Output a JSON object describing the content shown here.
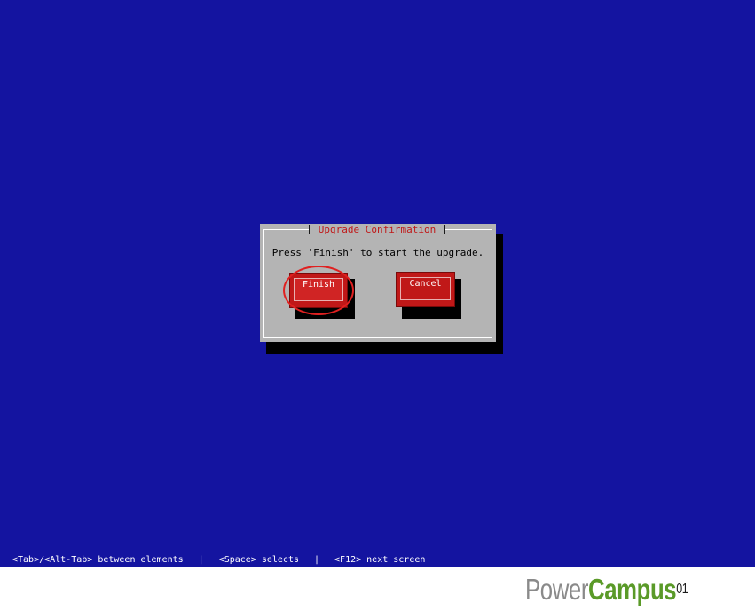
{
  "dialog": {
    "title": "Upgrade Confirmation",
    "message": "Press 'Finish' to start the upgrade.",
    "finish_label": "Finish",
    "cancel_label": "Cancel"
  },
  "statusbar": {
    "hint_tab": "<Tab>/<Alt-Tab> between elements",
    "separator": "|",
    "hint_space": "<Space> selects",
    "hint_f12": "<F12> next screen"
  },
  "logo": {
    "part1": "Power",
    "part2": "Campus",
    "superscript": "01"
  },
  "colors": {
    "screen_bg": "#1414a0",
    "dialog_bg": "#b4b4b4",
    "button_red": "#c01818",
    "title_red": "#c01818",
    "logo_gray": "#8a8a8a",
    "logo_green": "#5a9a28"
  }
}
